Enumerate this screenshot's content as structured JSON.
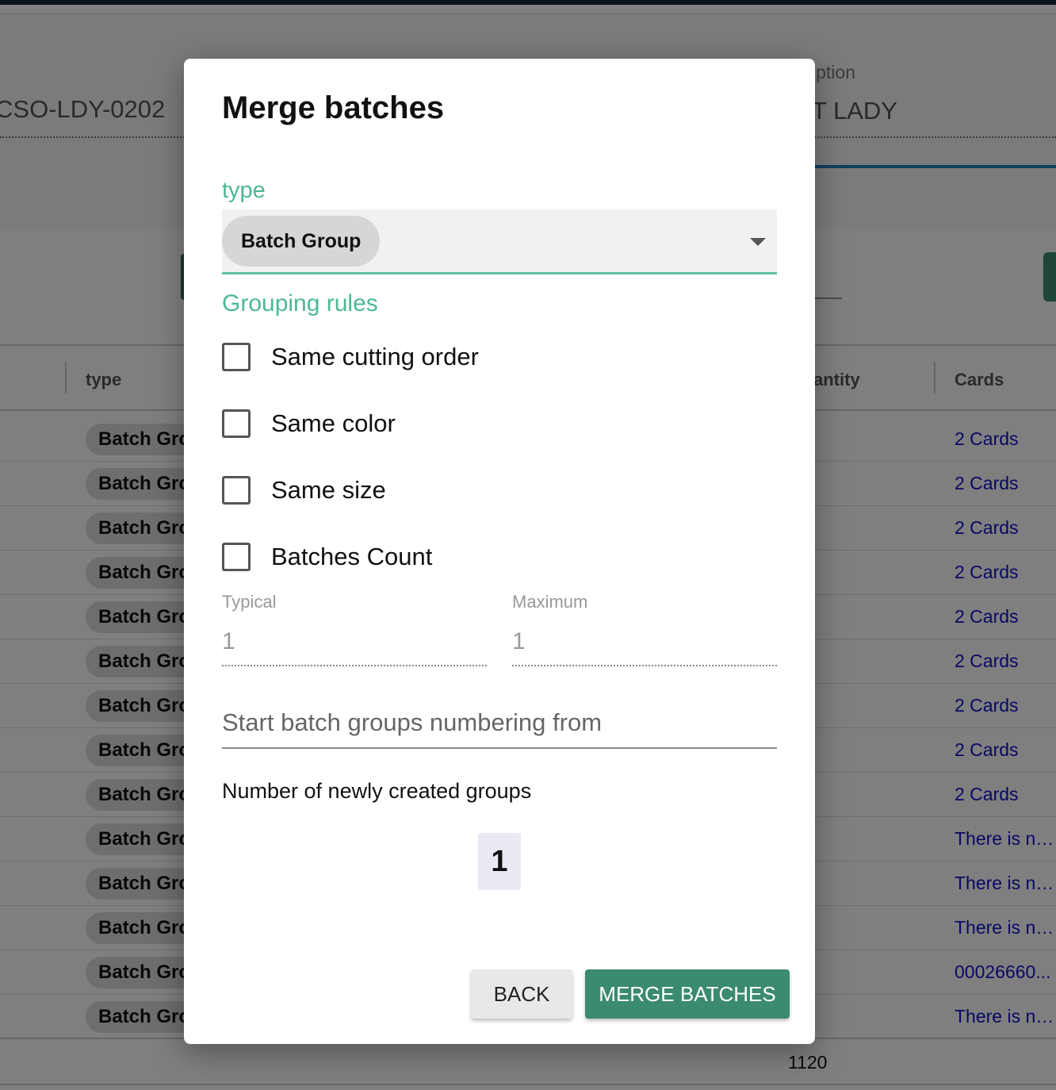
{
  "background": {
    "order_code": "CSO-LDY-0202",
    "description_label": "iption",
    "description_value": "T LADY",
    "table": {
      "col_type": "type",
      "col_quantity": "antity",
      "col_cards": "Cards",
      "rows": [
        {
          "type": "Batch Group",
          "cards": "2 Cards"
        },
        {
          "type": "Batch Group",
          "cards": "2 Cards"
        },
        {
          "type": "Batch Group",
          "cards": "2 Cards"
        },
        {
          "type": "Batch Group",
          "cards": "2 Cards"
        },
        {
          "type": "Batch Group",
          "cards": "2 Cards"
        },
        {
          "type": "Batch Group",
          "cards": "2 Cards"
        },
        {
          "type": "Batch Group",
          "cards": "2 Cards"
        },
        {
          "type": "Batch Group",
          "cards": "2 Cards"
        },
        {
          "type": "Batch Group",
          "cards": "2 Cards"
        },
        {
          "type": "Batch Group",
          "cards": "There is no..."
        },
        {
          "type": "Batch Group",
          "cards": "There is no..."
        },
        {
          "type": "Batch Group",
          "cards": "There is no..."
        },
        {
          "type": "Batch Group",
          "cards": "00026660..."
        },
        {
          "type": "Batch Group",
          "cards": "There is no..."
        }
      ],
      "total_quantity": "1120"
    }
  },
  "dialog": {
    "title": "Merge batches",
    "type_label": "type",
    "type_value": "Batch Group",
    "grouping_rules_label": "Grouping rules",
    "rules": {
      "same_cutting_order": {
        "label": "Same cutting order",
        "checked": false
      },
      "same_color": {
        "label": "Same color",
        "checked": false
      },
      "same_size": {
        "label": "Same size",
        "checked": false
      },
      "batches_count": {
        "label": "Batches Count",
        "checked": false
      }
    },
    "typical": {
      "label": "Typical",
      "value": "1"
    },
    "maximum": {
      "label": "Maximum",
      "value": "1"
    },
    "start_numbering_placeholder": "Start batch groups numbering from",
    "newly_created_label": "Number of newly created groups",
    "newly_created_value": "1",
    "back_label": "BACK",
    "merge_label": "MERGE BATCHES"
  },
  "colors": {
    "accent_green": "#4db895",
    "primary_button": "#3b8a72",
    "link_blue": "#1010c8"
  }
}
